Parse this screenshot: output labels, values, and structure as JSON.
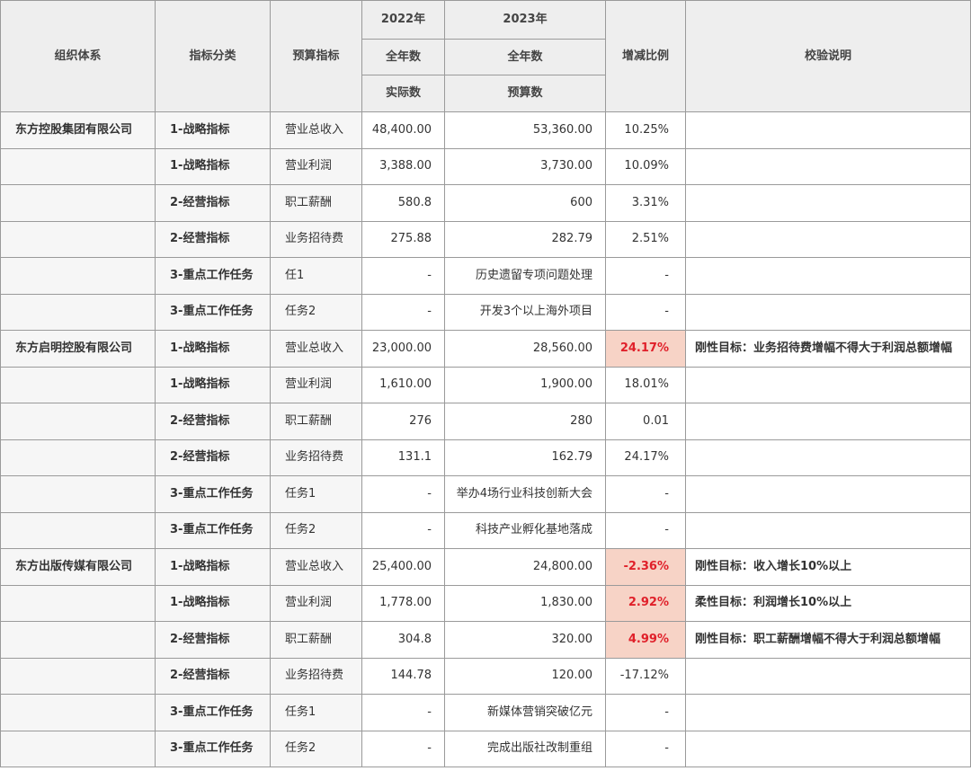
{
  "header": {
    "org": "组织体系",
    "category": "指标分类",
    "indicator": "预算指标",
    "year_2022": "2022年",
    "year_2023": "2023年",
    "full_year_2022": "全年数",
    "full_year_2023": "全年数",
    "actual": "实际数",
    "budget": "预算数",
    "change": "增减比例",
    "note": "校验说明"
  },
  "rows": [
    {
      "org": "东方控股集团有限公司",
      "category": "1-战略指标",
      "indicator": "营业总收入",
      "v2022": "48,400.00",
      "v2023": "53,360.00",
      "rate": "10.25%",
      "alert": false,
      "note": ""
    },
    {
      "org": "",
      "category": "1-战略指标",
      "indicator": "营业利润",
      "v2022": "3,388.00",
      "v2023": "3,730.00",
      "rate": "10.09%",
      "alert": false,
      "note": ""
    },
    {
      "org": "",
      "category": "2-经营指标",
      "indicator": "职工薪酬",
      "v2022": "580.8",
      "v2023": "600",
      "rate": "3.31%",
      "alert": false,
      "note": ""
    },
    {
      "org": "",
      "category": "2-经营指标",
      "indicator": "业务招待费",
      "v2022": "275.88",
      "v2023": "282.79",
      "rate": "2.51%",
      "alert": false,
      "note": ""
    },
    {
      "org": "",
      "category": "3-重点工作任务",
      "indicator": "任1",
      "v2022": "-",
      "v2023": "历史遗留专项问题处理",
      "rate": "-",
      "alert": false,
      "note": ""
    },
    {
      "org": "",
      "category": "3-重点工作任务",
      "indicator": "任务2",
      "v2022": "-",
      "v2023": "开发3个以上海外项目",
      "rate": "-",
      "alert": false,
      "note": ""
    },
    {
      "org": "东方启明控股有限公司",
      "category": "1-战略指标",
      "indicator": "营业总收入",
      "v2022": "23,000.00",
      "v2023": "28,560.00",
      "rate": "24.17%",
      "alert": true,
      "note": "刚性目标：业务招待费增幅不得大于利润总额增幅"
    },
    {
      "org": "",
      "category": "1-战略指标",
      "indicator": "营业利润",
      "v2022": "1,610.00",
      "v2023": "1,900.00",
      "rate": "18.01%",
      "alert": false,
      "note": ""
    },
    {
      "org": "",
      "category": "2-经营指标",
      "indicator": "职工薪酬",
      "v2022": "276",
      "v2023": "280",
      "rate": "0.01",
      "alert": false,
      "note": ""
    },
    {
      "org": "",
      "category": "2-经营指标",
      "indicator": "业务招待费",
      "v2022": "131.1",
      "v2023": "162.79",
      "rate": "24.17%",
      "alert": false,
      "note": ""
    },
    {
      "org": "",
      "category": "3-重点工作任务",
      "indicator": "任务1",
      "v2022": "-",
      "v2023": "举办4场行业科技创新大会",
      "rate": "-",
      "alert": false,
      "note": ""
    },
    {
      "org": "",
      "category": "3-重点工作任务",
      "indicator": "任务2",
      "v2022": "-",
      "v2023": "科技产业孵化基地落成",
      "rate": "-",
      "alert": false,
      "note": ""
    },
    {
      "org": "东方出版传媒有限公司",
      "category": "1-战略指标",
      "indicator": "营业总收入",
      "v2022": "25,400.00",
      "v2023": "24,800.00",
      "rate": "-2.36%",
      "alert": true,
      "note": "刚性目标：收入增长10%以上"
    },
    {
      "org": "",
      "category": "1-战略指标",
      "indicator": "营业利润",
      "v2022": "1,778.00",
      "v2023": "1,830.00",
      "rate": "2.92%",
      "alert": true,
      "note": "柔性目标：利润增长10%以上"
    },
    {
      "org": "",
      "category": "2-经营指标",
      "indicator": "职工薪酬",
      "v2022": "304.8",
      "v2023": "320.00",
      "rate": "4.99%",
      "alert": true,
      "note": "刚性目标：职工薪酬增幅不得大于利润总额增幅"
    },
    {
      "org": "",
      "category": "2-经营指标",
      "indicator": "业务招待费",
      "v2022": "144.78",
      "v2023": "120.00",
      "rate": "-17.12%",
      "alert": false,
      "note": ""
    },
    {
      "org": "",
      "category": "3-重点工作任务",
      "indicator": "任务1",
      "v2022": "-",
      "v2023": "新媒体营销突破亿元",
      "rate": "-",
      "alert": false,
      "note": ""
    },
    {
      "org": "",
      "category": "3-重点工作任务",
      "indicator": "任务2",
      "v2022": "-",
      "v2023": "完成出版社改制重组",
      "rate": "-",
      "alert": false,
      "note": ""
    }
  ]
}
